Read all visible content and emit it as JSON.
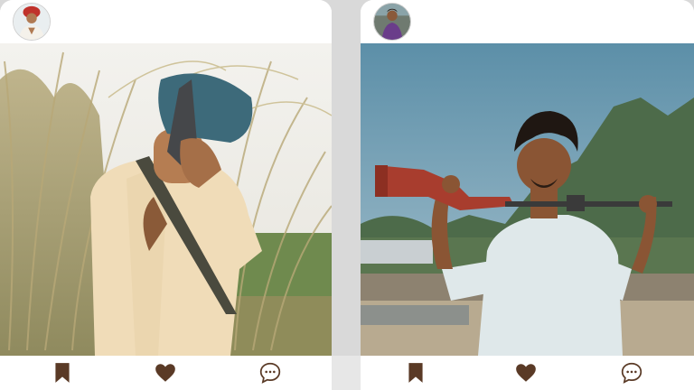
{
  "feed": {
    "posts": [
      {
        "avatar_icon": "profile-photo-turban-man",
        "image_icon": "photo-man-with-turban-holding-pistol-in-grass",
        "actions": [
          {
            "icon": "bookmark-icon"
          },
          {
            "icon": "heart-icon"
          },
          {
            "icon": "comment-icon"
          }
        ]
      },
      {
        "avatar_icon": "profile-photo-man-purple-shirt",
        "image_icon": "photo-man-holding-rifle-on-shoulders",
        "actions": [
          {
            "icon": "bookmark-icon"
          },
          {
            "icon": "heart-icon"
          },
          {
            "icon": "comment-icon"
          }
        ]
      }
    ]
  },
  "colors": {
    "icon_brown": "#5a3a26",
    "card_bg": "#ffffff",
    "page_bg": "#d9d9d9"
  }
}
